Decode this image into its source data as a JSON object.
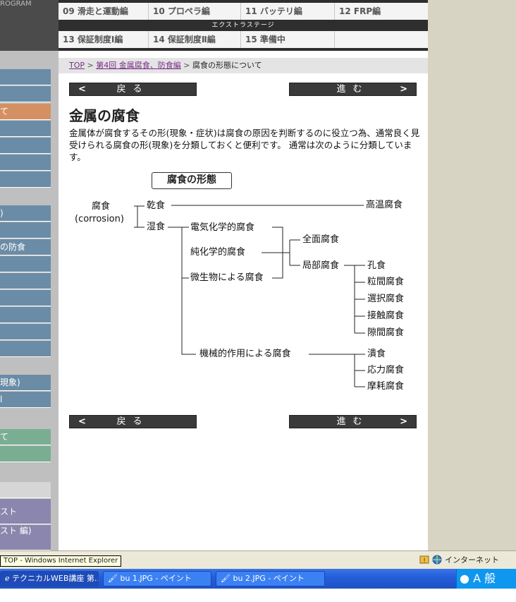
{
  "header": {
    "program_label": "ROGRAM"
  },
  "top_nav": {
    "row1": [
      "09 滑走と運動編",
      "10 プロペラ編",
      "11 バッテリ編",
      "12 FRP編"
    ],
    "extra_stage": "エクストラステージ",
    "row2": [
      "13 保証制度Ⅰ編",
      "14 保証制度Ⅱ編",
      "15 準備中",
      ""
    ]
  },
  "sidebar": {
    "items": [
      "",
      "",
      "て",
      "",
      "",
      "",
      "",
      ")",
      "",
      "の防食",
      "",
      "",
      "",
      "",
      "",
      "",
      "現象)",
      "l",
      "",
      "て",
      "",
      "",
      "スト",
      "スト 編)"
    ]
  },
  "breadcrumb": {
    "top": "TOP",
    "sep": ">",
    "section": "第4回 金属腐食、防食編",
    "current": "腐食の形態について"
  },
  "nav_buttons": {
    "back": "戻る",
    "forward": "進む",
    "left_arrow": "<",
    "right_arrow": ">"
  },
  "page": {
    "heading": "金属の腐食",
    "intro": "金属体が腐食するその形(現象・症状)は腐食の原因を判断するのに役立つ為、通常良く見受けられる腐食の形(現象)を分類しておくと便利です。 通常は次のように分類しています。"
  },
  "diagram": {
    "title": "腐食の形態",
    "root": "腐食",
    "root_en": "(corrosion)",
    "dry": "乾食",
    "high_temp": "高温腐食",
    "wet": "湿食",
    "electrochemical": "電気化学的腐食",
    "pure_chemical": "純化学的腐食",
    "microbial": "微生物による腐食",
    "general": "全面腐食",
    "local": "局部腐食",
    "pitting": "孔食",
    "intergranular": "粒間腐食",
    "selective": "選択腐食",
    "contact": "接触腐食",
    "crevice": "隙間腐食",
    "mechanical": "機械的作用による腐食",
    "erosion": "潰食",
    "stress": "応力腐食",
    "wear": "摩耗腐食"
  },
  "statusbar": {
    "tooltip": "TOP - Windows Internet Explorer",
    "zone": "インターネット"
  },
  "taskbar": {
    "items": [
      "テクニカルWEB講座 第...",
      "bu 1.JPG - ペイント",
      "bu 2.JPG - ペイント"
    ],
    "tray_text": "A 般"
  },
  "colors": {
    "sidebar_blue": "#6b8ca6",
    "sidebar_active": "#d49062",
    "sidebar_green": "#7aae93",
    "sidebar_purple": "#8b86ad",
    "link_purple": "#7a2e8a",
    "nav_button_bg": "#3a3a3a"
  }
}
